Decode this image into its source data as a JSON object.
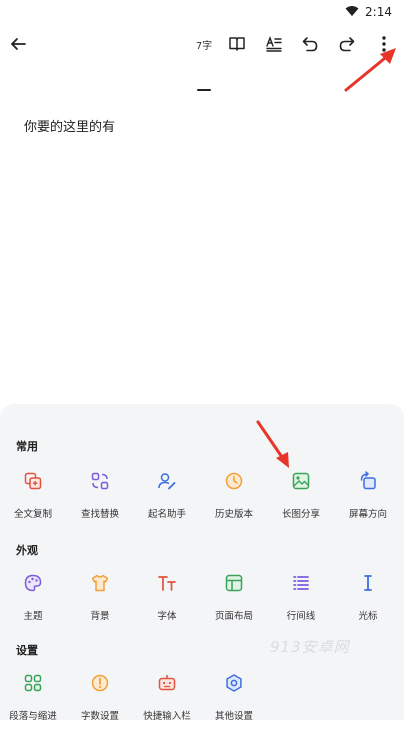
{
  "status_bar": {
    "time": "2:14"
  },
  "toolbar": {
    "word_count": "7字"
  },
  "document": {
    "body_text": "你要的这里的有"
  },
  "sections": [
    {
      "title": "常用",
      "items": [
        {
          "label": "全文复制",
          "icon": "copy-all-icon",
          "color": "#e0533e"
        },
        {
          "label": "查找替换",
          "icon": "find-replace-icon",
          "color": "#7c5ce0"
        },
        {
          "label": "起名助手",
          "icon": "naming-assistant-icon",
          "color": "#3c6fe0"
        },
        {
          "label": "历史版本",
          "icon": "history-icon",
          "color": "#f0a13a"
        },
        {
          "label": "长图分享",
          "icon": "image-share-icon",
          "color": "#3aa35a"
        },
        {
          "label": "屏幕方向",
          "icon": "rotate-screen-icon",
          "color": "#3c6fe0"
        }
      ]
    },
    {
      "title": "外观",
      "items": [
        {
          "label": "主题",
          "icon": "palette-icon",
          "color": "#7c5ce0"
        },
        {
          "label": "背景",
          "icon": "shirt-icon",
          "color": "#f0a13a"
        },
        {
          "label": "字体",
          "icon": "font-icon",
          "color": "#e0533e"
        },
        {
          "label": "页面布局",
          "icon": "layout-icon",
          "color": "#3aa35a"
        },
        {
          "label": "行间线",
          "icon": "line-spacing-icon",
          "color": "#7c5ce0"
        },
        {
          "label": "光标",
          "icon": "cursor-icon",
          "color": "#3c6fe0"
        }
      ]
    },
    {
      "title": "设置",
      "items": [
        {
          "label": "段落与缩进",
          "icon": "paragraph-indent-icon",
          "color": "#3aa35a"
        },
        {
          "label": "字数设置",
          "icon": "word-count-setting-icon",
          "color": "#f0a13a"
        },
        {
          "label": "快捷输入栏",
          "icon": "quick-input-bar-icon",
          "color": "#e0533e"
        },
        {
          "label": "其他设置",
          "icon": "gear-icon",
          "color": "#3c6fe0"
        }
      ]
    }
  ],
  "watermark": "913安卓网",
  "colors": {
    "annotation_arrow": "#e8352a",
    "sheet_bg": "#f4f5f7"
  }
}
